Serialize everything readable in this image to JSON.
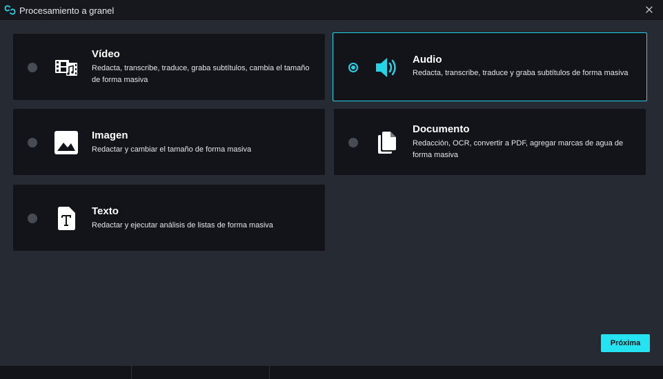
{
  "window": {
    "title": "Procesamiento a granel"
  },
  "options": [
    {
      "title": "Vídeo",
      "description": "Redacta, transcribe, traduce, graba subtítulos, cambia el tamaño de forma masiva",
      "icon": "video-film-icon",
      "selected": false
    },
    {
      "title": "Audio",
      "description": "Redacta, transcribe, traduce y graba subtítulos de forma masiva",
      "icon": "speaker-icon",
      "selected": true
    },
    {
      "title": "Imagen",
      "description": "Redactar y cambiar el tamaño de forma masiva",
      "icon": "image-icon",
      "selected": false
    },
    {
      "title": "Documento",
      "description": "Redacción, OCR, convertir a PDF, agregar marcas de agua de forma masiva",
      "icon": "document-icon",
      "selected": false
    },
    {
      "title": "Texto",
      "description": "Redactar y ejecutar análisis de listas de forma masiva",
      "icon": "text-file-icon",
      "selected": false
    }
  ],
  "footer": {
    "next_label": "Próxima"
  },
  "colors": {
    "accent": "#25d3e6",
    "button": "#25e3f0",
    "background": "#262a33",
    "card": "#121419"
  }
}
